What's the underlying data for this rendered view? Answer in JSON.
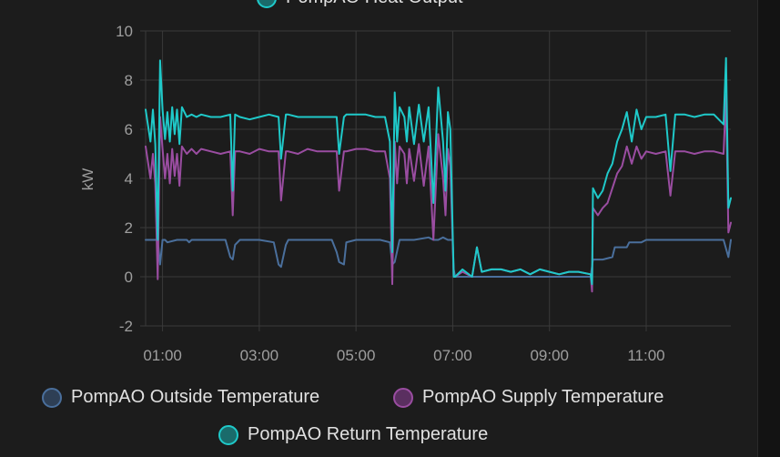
{
  "chart_data": {
    "type": "line",
    "ylabel": "kW",
    "ylim": [
      -2,
      10
    ],
    "yticks": [
      "10",
      "8",
      "6",
      "4",
      "2",
      "0",
      "-2"
    ],
    "xlim_hours": [
      0.65,
      12.75
    ],
    "xticks": [
      "01:00",
      "03:00",
      "05:00",
      "07:00",
      "09:00",
      "11:00"
    ],
    "grid": true,
    "legend_position": "bottom",
    "top_legend_label": "PompAO Heat Output",
    "series": [
      {
        "name": "PompAO Outside Temperature",
        "color": "#4a6f9c",
        "x": [
          0.65,
          0.9,
          0.95,
          1.0,
          1.05,
          1.1,
          1.3,
          1.5,
          1.55,
          1.6,
          2.0,
          2.3,
          2.4,
          2.45,
          2.5,
          2.6,
          2.7,
          3.0,
          3.3,
          3.4,
          3.45,
          3.55,
          3.6,
          3.8,
          4.0,
          4.5,
          4.6,
          4.65,
          4.75,
          4.8,
          5.0,
          5.5,
          5.7,
          5.75,
          5.8,
          5.9,
          6.0,
          6.2,
          6.5,
          6.6,
          6.7,
          6.8,
          6.9,
          7.0,
          7.02,
          7.05,
          7.5,
          8.0,
          8.5,
          9.0,
          9.5,
          9.85,
          9.9,
          10.1,
          10.3,
          10.35,
          10.6,
          10.65,
          10.9,
          11.0,
          11.5,
          12.0,
          12.5,
          12.6,
          12.7,
          12.75
        ],
        "y": [
          1.5,
          1.5,
          0.5,
          1.5,
          1.5,
          1.4,
          1.5,
          1.5,
          1.4,
          1.5,
          1.5,
          1.5,
          0.8,
          0.7,
          1.3,
          1.5,
          1.5,
          1.5,
          1.4,
          0.5,
          0.4,
          1.3,
          1.5,
          1.5,
          1.5,
          1.5,
          1.0,
          0.6,
          0.5,
          1.4,
          1.5,
          1.5,
          1.4,
          0.5,
          0.6,
          1.5,
          1.5,
          1.5,
          1.6,
          1.5,
          1.5,
          1.6,
          1.5,
          1.5,
          0.3,
          0.0,
          0.0,
          0.0,
          0.0,
          0.0,
          0.0,
          0.0,
          0.7,
          0.7,
          0.8,
          1.2,
          1.2,
          1.4,
          1.4,
          1.5,
          1.5,
          1.5,
          1.5,
          1.5,
          0.8,
          1.5
        ]
      },
      {
        "name": "PompAO Supply Temperature",
        "color": "#9a4da1",
        "x": [
          0.65,
          0.75,
          0.8,
          0.85,
          0.9,
          0.95,
          1.0,
          1.05,
          1.1,
          1.15,
          1.2,
          1.25,
          1.3,
          1.35,
          1.4,
          1.5,
          1.6,
          1.7,
          1.8,
          2.0,
          2.2,
          2.4,
          2.45,
          2.5,
          2.6,
          2.8,
          3.0,
          3.2,
          3.4,
          3.45,
          3.55,
          3.6,
          3.8,
          4.0,
          4.2,
          4.6,
          4.65,
          4.75,
          4.8,
          5.0,
          5.2,
          5.4,
          5.6,
          5.7,
          5.75,
          5.8,
          5.85,
          5.9,
          6.0,
          6.05,
          6.1,
          6.2,
          6.3,
          6.4,
          6.5,
          6.6,
          6.7,
          6.8,
          6.85,
          6.9,
          6.95,
          7.02,
          7.05,
          7.2,
          7.4,
          7.5,
          7.6,
          7.8,
          8.0,
          8.2,
          8.4,
          8.6,
          8.8,
          9.0,
          9.2,
          9.4,
          9.6,
          9.85,
          9.88,
          9.9,
          10.0,
          10.1,
          10.2,
          10.3,
          10.4,
          10.5,
          10.6,
          10.7,
          10.8,
          10.9,
          11.0,
          11.2,
          11.4,
          11.5,
          11.6,
          11.8,
          12.0,
          12.2,
          12.4,
          12.6,
          12.65,
          12.7,
          12.75
        ],
        "y": [
          5.3,
          4.0,
          5.0,
          3.8,
          -0.1,
          6.5,
          5.2,
          4.0,
          5.0,
          3.8,
          5.2,
          4.1,
          5.0,
          3.7,
          5.3,
          5.0,
          5.2,
          5.0,
          5.2,
          5.1,
          5.0,
          5.1,
          2.5,
          5.1,
          5.1,
          5.0,
          5.2,
          5.1,
          5.1,
          3.1,
          5.1,
          5.1,
          5.0,
          5.2,
          5.1,
          5.1,
          3.5,
          5.1,
          5.1,
          5.2,
          5.2,
          5.1,
          5.1,
          4.0,
          -0.3,
          5.5,
          3.8,
          5.3,
          5.0,
          3.8,
          5.2,
          3.9,
          5.4,
          3.7,
          5.3,
          1.5,
          5.8,
          4.0,
          2.5,
          5.2,
          4.5,
          0.0,
          0.0,
          0.2,
          0.0,
          1.2,
          0.2,
          0.3,
          0.3,
          0.2,
          0.3,
          0.1,
          0.3,
          0.2,
          0.1,
          0.2,
          0.2,
          0.1,
          -0.6,
          2.8,
          2.5,
          2.8,
          3.0,
          3.6,
          4.2,
          4.5,
          5.3,
          4.6,
          5.3,
          4.8,
          5.1,
          5.0,
          5.1,
          3.3,
          5.1,
          5.1,
          5.0,
          5.1,
          5.1,
          5.0,
          7.4,
          1.8,
          2.2
        ]
      },
      {
        "name": "PompAO Return Temperature",
        "color": "#1fc9c9",
        "x": [
          0.65,
          0.75,
          0.8,
          0.85,
          0.9,
          0.95,
          1.0,
          1.05,
          1.1,
          1.15,
          1.2,
          1.25,
          1.3,
          1.35,
          1.4,
          1.5,
          1.6,
          1.7,
          1.8,
          2.0,
          2.2,
          2.4,
          2.45,
          2.5,
          2.6,
          2.8,
          3.0,
          3.2,
          3.4,
          3.45,
          3.55,
          3.6,
          3.8,
          4.0,
          4.2,
          4.6,
          4.65,
          4.75,
          4.8,
          5.0,
          5.2,
          5.4,
          5.6,
          5.7,
          5.75,
          5.8,
          5.85,
          5.9,
          6.0,
          6.05,
          6.1,
          6.2,
          6.3,
          6.4,
          6.5,
          6.6,
          6.7,
          6.8,
          6.85,
          6.9,
          6.95,
          7.02,
          7.05,
          7.2,
          7.4,
          7.5,
          7.6,
          7.8,
          8.0,
          8.2,
          8.4,
          8.6,
          8.8,
          9.0,
          9.2,
          9.4,
          9.6,
          9.85,
          9.88,
          9.9,
          10.0,
          10.1,
          10.2,
          10.3,
          10.4,
          10.5,
          10.6,
          10.7,
          10.8,
          10.9,
          11.0,
          11.2,
          11.4,
          11.5,
          11.6,
          11.8,
          12.0,
          12.2,
          12.4,
          12.6,
          12.65,
          12.7,
          12.75
        ],
        "y": [
          6.8,
          5.5,
          6.8,
          5.4,
          1.5,
          8.8,
          6.8,
          5.6,
          6.7,
          5.5,
          6.9,
          5.8,
          6.8,
          5.4,
          6.9,
          6.5,
          6.6,
          6.5,
          6.6,
          6.5,
          6.5,
          6.6,
          3.5,
          6.6,
          6.5,
          6.4,
          6.5,
          6.6,
          6.5,
          4.8,
          6.6,
          6.6,
          6.5,
          6.5,
          6.5,
          6.5,
          5.0,
          6.5,
          6.6,
          6.6,
          6.6,
          6.5,
          6.5,
          5.5,
          1.0,
          7.5,
          5.5,
          6.9,
          6.5,
          5.5,
          6.9,
          5.4,
          7.0,
          5.5,
          6.9,
          3.0,
          7.7,
          5.5,
          3.5,
          6.7,
          6.0,
          0.0,
          0.0,
          0.3,
          0.0,
          1.2,
          0.2,
          0.3,
          0.3,
          0.2,
          0.3,
          0.1,
          0.3,
          0.2,
          0.1,
          0.2,
          0.2,
          0.1,
          -0.3,
          3.6,
          3.2,
          3.5,
          4.2,
          4.6,
          5.5,
          6.0,
          6.7,
          5.5,
          6.8,
          6.0,
          6.5,
          6.5,
          6.6,
          4.3,
          6.6,
          6.6,
          6.5,
          6.6,
          6.6,
          6.2,
          8.9,
          2.8,
          3.2
        ]
      }
    ]
  }
}
